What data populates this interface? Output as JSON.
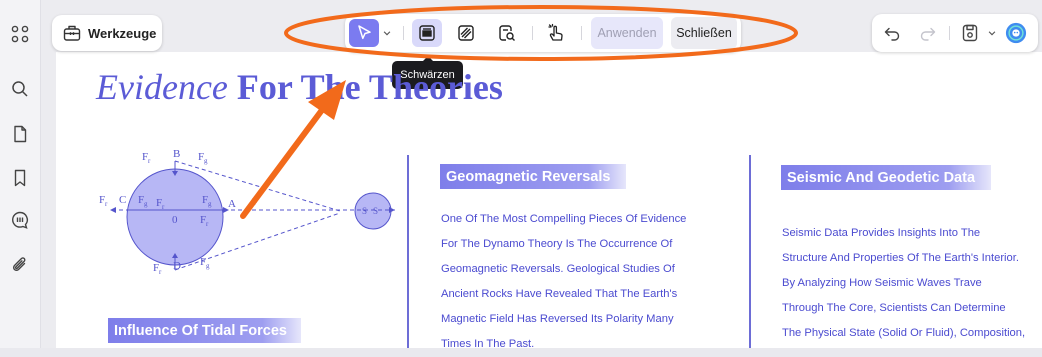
{
  "sidebar": {
    "items": [
      "grid-icon",
      "search-icon",
      "page-icon",
      "bookmark-icon",
      "comment-icon",
      "attachment-icon"
    ]
  },
  "toolbar": {
    "tools_label": "Werkzeuge",
    "apply_label": "Anwenden",
    "close_label": "Schließen",
    "tooltip": "Schwärzen",
    "accent": "#7b7bf0"
  },
  "document": {
    "title_italic": "Evidence",
    "title_bold": "For The Theories",
    "diagram": {
      "labels": [
        "F",
        "B",
        "F",
        "F",
        "C",
        "F",
        "F",
        "0",
        "F",
        "A",
        "F",
        "F",
        "F",
        "D",
        "F",
        "S",
        "S"
      ],
      "subscripts": [
        "r",
        "g",
        "r",
        "g",
        "r",
        "g",
        "r",
        "r",
        "g"
      ]
    },
    "col1_heading": "Influence Of Tidal Forces",
    "col2_heading": "Geomagnetic Reversals",
    "col2_lines": [
      "One Of The Most Compelling Pieces Of Evidence",
      "For The Dynamo Theory Is The Occurrence Of",
      "Geomagnetic Reversals. Geological Studies Of",
      "Ancient Rocks Have Revealed That The Earth's",
      "Magnetic Field Has Reversed Its Polarity Many",
      "Times In The Past."
    ],
    "col3_heading": "Seismic And Geodetic Data",
    "col3_lines": [
      "Seismic Data Provides Insights Into The",
      "Structure And Properties Of The Earth's Interior.",
      "By Analyzing How Seismic Waves Trave",
      "Through The Core, Scientists Can Determine",
      "The Physical State (Solid Or Fluid), Composition,"
    ]
  }
}
